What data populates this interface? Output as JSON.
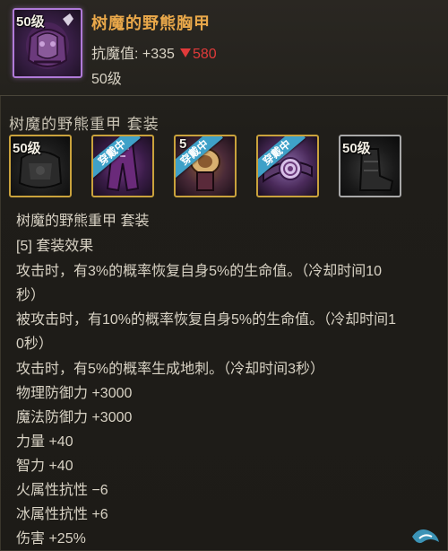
{
  "item": {
    "level_badge": "50级",
    "name": "树魔的野熊胸甲",
    "stat_label": "抗魔值: ",
    "stat_value": "+335",
    "stat_delta": "580",
    "level": "50级",
    "icon": "purple-chest-armor-icon"
  },
  "set": {
    "title": "树魔的野熊重甲  套装",
    "pieces": [
      {
        "badge": "50级",
        "ribbon": "",
        "icon": "dark-shoulder-armor-icon",
        "border": "#c9a23c"
      },
      {
        "badge": "",
        "ribbon": "穿戴中",
        "icon": "purple-pants-icon",
        "border": "#c9a23c"
      },
      {
        "badge": "5",
        "ribbon": "穿戴中",
        "icon": "belt-buckle-icon",
        "border": "#c9a23c"
      },
      {
        "badge": "",
        "ribbon": "穿戴中",
        "icon": "spiral-belt-icon",
        "border": "#c9a23c"
      },
      {
        "badge": "50级",
        "ribbon": "",
        "icon": "dark-boots-icon",
        "border": "#a8a8a8"
      }
    ]
  },
  "details": {
    "lines": [
      "树魔的野熊重甲  套装",
      "[5] 套装效果",
      "攻击时，有3%的概率恢复自身5%的生命值。（冷却时间10",
      "秒）",
      "被攻击时，有10%的概率恢复自身5%的生命值。（冷却时间1",
      "0秒）",
      "攻击时，有5%的概率生成地刺。（冷却时间3秒）",
      "物理防御力 +3000",
      "魔法防御力 +3000",
      "力量 +40",
      "智力 +40",
      "火属性抗性 −6",
      "冰属性抗性 +6",
      "伤害 +25%"
    ]
  },
  "colors": {
    "name": "#e9a84a",
    "down": "#e03a3a",
    "text": "#d8d2c4",
    "epic_border": "#b07ad8",
    "legend_border": "#c9a23c",
    "ribbon": "#3fa1c8"
  }
}
